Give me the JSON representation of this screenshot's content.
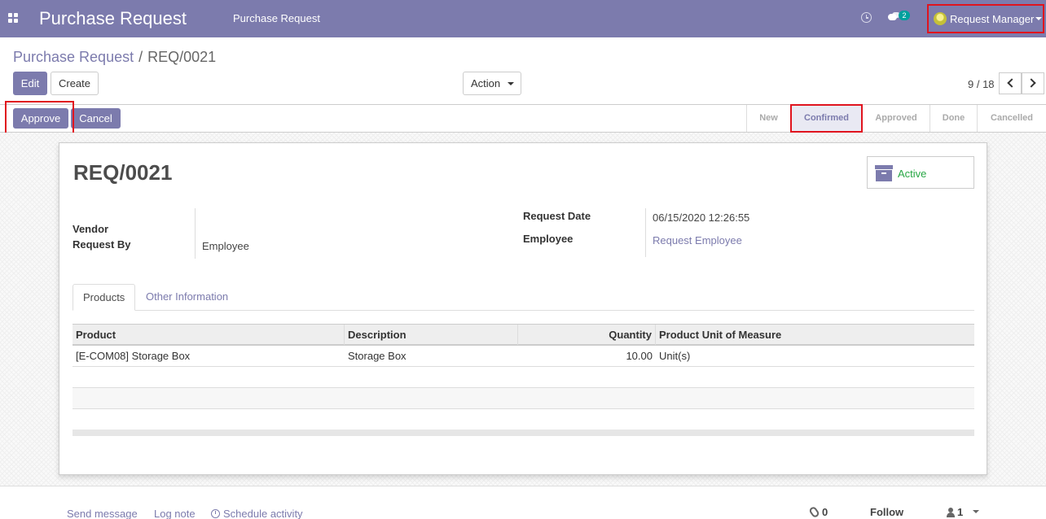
{
  "navbar": {
    "app_title": "Purchase Request",
    "menu_item": "Purchase Request",
    "chat_count": "2",
    "user_name": "Request Manager"
  },
  "breadcrumb": {
    "parent": "Purchase Request",
    "separator": "/",
    "current": "REQ/0021"
  },
  "toolbar": {
    "edit_label": "Edit",
    "create_label": "Create",
    "action_label": "Action",
    "pager_value": "9 / 18"
  },
  "statusbar": {
    "approve_label": "Approve",
    "cancel_label": "Cancel",
    "stages": [
      "New",
      "Confirmed",
      "Approved",
      "Done",
      "Cancelled"
    ],
    "current_stage": "Confirmed"
  },
  "record": {
    "name": "REQ/0021",
    "active_label": "Active",
    "fields": {
      "vendor_label": "Vendor",
      "vendor_value": "",
      "request_by_label": "Request By",
      "request_by_value": "Employee",
      "request_date_label": "Request Date",
      "request_date_value": "06/15/2020 12:26:55",
      "employee_label": "Employee",
      "employee_value": "Request Employee"
    }
  },
  "tabs": [
    "Products",
    "Other Information"
  ],
  "products_table": {
    "columns": [
      "Product",
      "Description",
      "Quantity",
      "Product Unit of Measure"
    ],
    "rows": [
      {
        "product": "[E-COM08] Storage Box",
        "description": "Storage Box",
        "quantity": "10.00",
        "uom": "Unit(s)"
      }
    ]
  },
  "chatter": {
    "send_message": "Send message",
    "log_note": "Log note",
    "schedule_activity": "Schedule activity",
    "attachments": "0",
    "follow": "Follow",
    "followers": "1"
  },
  "colors": {
    "brand": "#7c7bad",
    "active_green": "#28a745",
    "highlight_red": "#e0141e"
  }
}
